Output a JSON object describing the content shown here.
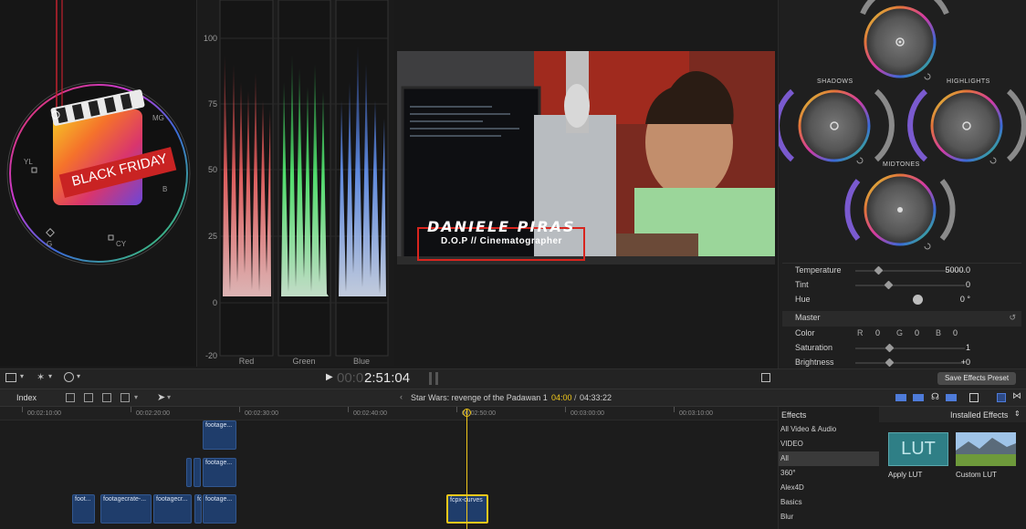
{
  "scope": {
    "labels": {
      "mg": "MG",
      "yl": "YL",
      "b": "B",
      "g": "G",
      "cy": "CY"
    },
    "badge": "BLACK FRIDAY"
  },
  "parade": {
    "ticks": [
      "100",
      "75",
      "50",
      "25",
      "0",
      "-20"
    ],
    "channels": [
      "Red",
      "Green",
      "Blue"
    ]
  },
  "viewer": {
    "overlay_name": "DANIELE PIRAS",
    "overlay_role": "D.O.P // Cinematographer"
  },
  "inspector": {
    "wheels": {
      "shadows": "SHADOWS",
      "highlights": "HIGHLIGHTS",
      "midtones": "MIDTONES"
    },
    "rows": {
      "temperature": {
        "label": "Temperature",
        "value": "5000.0"
      },
      "tint": {
        "label": "Tint",
        "value": "0"
      },
      "hue": {
        "label": "Hue",
        "value": "0 °"
      },
      "master": {
        "label": "Master"
      },
      "color": {
        "label": "Color",
        "r_label": "R",
        "r": "0",
        "g_label": "G",
        "g": "0",
        "b_label": "B",
        "b": "0"
      },
      "saturation": {
        "label": "Saturation",
        "value": "1"
      },
      "brightness": {
        "label": "Brightness",
        "value": "+0"
      }
    },
    "save_preset": "Save Effects Preset"
  },
  "toolbar": {
    "timecode_dim": "00:0",
    "timecode": "2:51:04"
  },
  "timeline": {
    "index_label": "Index",
    "project_title": "Star Wars: revenge of the Padawan 1",
    "current": "04:00",
    "separator": "/",
    "duration": "04:33:22",
    "ruler": [
      "00:02:10:00",
      "00:02:20:00",
      "00:02:30:00",
      "00:02:40:00",
      "00:02:50:00",
      "00:03:00:00",
      "00:03:10:00"
    ],
    "clips": {
      "c1": "footage...",
      "c2": "footage...",
      "c3": "foot...",
      "c4": "footagecrate-...",
      "c5": "footagecr...",
      "c6": "fo",
      "c7": "footage...",
      "c8": "fcpx-curves"
    }
  },
  "effects": {
    "title": "Effects",
    "installed": "Installed Effects",
    "categories": [
      "All Video & Audio",
      "VIDEO",
      "All",
      "360°",
      "Alex4D",
      "Basics",
      "Blur"
    ],
    "selected_index": 2,
    "items": [
      {
        "name": "Apply LUT",
        "thumb_text": "LUT"
      },
      {
        "name": "Custom LUT"
      }
    ]
  },
  "colors": {
    "accent": "#f2c81b",
    "clip_blue": "#1f3d6b",
    "selected_category": "#3a3a3a"
  }
}
